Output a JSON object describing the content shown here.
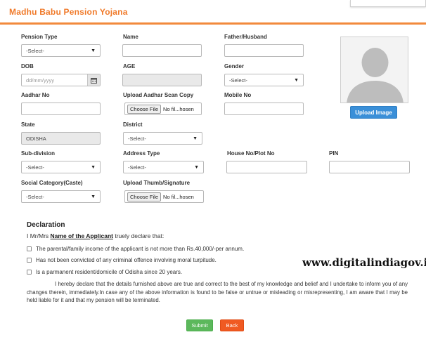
{
  "header": {
    "title": "Madhu Babu Pension Yojana"
  },
  "form": {
    "pension_type": {
      "label": "Pension Type",
      "value": "-Select-"
    },
    "name": {
      "label": "Name",
      "value": ""
    },
    "father_husband": {
      "label": "Father/Husband",
      "value": ""
    },
    "dob": {
      "label": "DOB",
      "placeholder": "dd/mm/yyyy"
    },
    "age": {
      "label": "AGE",
      "value": ""
    },
    "gender": {
      "label": "Gender",
      "value": "-Select-"
    },
    "aadhar_no": {
      "label": "Aadhar No",
      "value": ""
    },
    "aadhar_scan": {
      "label": "Upload Aadhar Scan Copy",
      "button": "Choose File",
      "file_text": "No fil...hosen"
    },
    "mobile_no": {
      "label": "Mobile No",
      "value": ""
    },
    "state": {
      "label": "State",
      "value": "ODISHA"
    },
    "district": {
      "label": "District",
      "value": "-Select-"
    },
    "sub_division": {
      "label": "Sub-division",
      "value": "-Select-"
    },
    "address_type": {
      "label": "Address Type",
      "value": "-Select-"
    },
    "house_no": {
      "label": "House No/Plot No",
      "value": ""
    },
    "pin": {
      "label": "PIN",
      "value": ""
    },
    "social_category": {
      "label": "Social Category(Caste)",
      "value": "-Select-"
    },
    "thumb_signature": {
      "label": "Upload Thumb/Signature",
      "button": "Choose File",
      "file_text": "No fil...hosen"
    }
  },
  "photo": {
    "upload_label": "Upload Image"
  },
  "declaration": {
    "title": "Declaration",
    "intro_prefix": "I Mr/Mrs",
    "intro_name": "Name of the Applicant",
    "intro_suffix": "truely declare that:",
    "items": [
      "The parental/family income of the applicant is not more than Rs.40,000/-per annum.",
      "Has not been convicted of any criminal offence involving moral turpitude.",
      "Is a parmanent resident/domicile of Odisha since 20 years."
    ],
    "paragraph": "I hereby declare that the details furnished above are true and correct to the best of my knowledge and belief and I undertake to inform you of any changes therein, immediately.In case any of the above information is found to be false or untrue or misleading or misrepresenting, I am aware that I may be held liable for it and that my pension will be terminated."
  },
  "watermark": "www.digitalindiagov.in",
  "actions": {
    "submit": "Submit",
    "back": "Back"
  },
  "colors": {
    "accent": "#f07a2a",
    "upload": "#3a8fd8",
    "submit": "#5cb85c",
    "back": "#f05a22"
  }
}
